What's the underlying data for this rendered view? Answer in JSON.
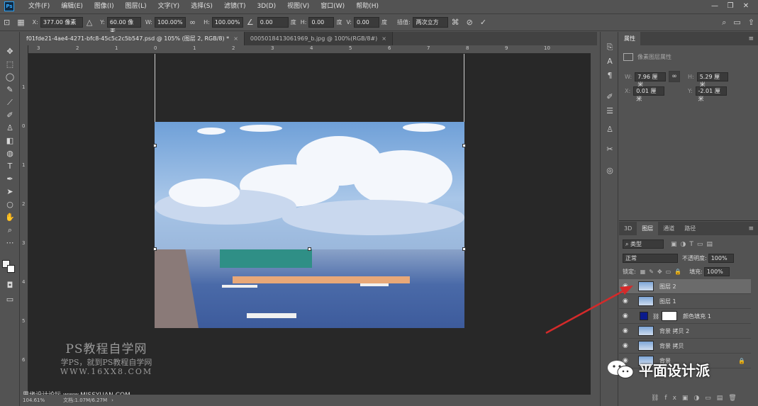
{
  "app": {
    "logo": "Ps"
  },
  "menu": [
    "文件(F)",
    "编辑(E)",
    "图像(I)",
    "图层(L)",
    "文字(Y)",
    "选择(S)",
    "滤镜(T)",
    "3D(D)",
    "视图(V)",
    "窗口(W)",
    "帮助(H)"
  ],
  "options": {
    "x_label": "X:",
    "x_value": "377.00 像素",
    "y_label": "Y:",
    "y_value": "60.00 像素",
    "w_label": "W:",
    "w_value": "100.00%",
    "h_label": "H:",
    "h_value": "100.00%",
    "angle_value": "0.00",
    "angle_unit": "度",
    "hskew_label": "H:",
    "hskew_value": "0.00",
    "hskew_unit": "度",
    "vskew_label": "V:",
    "vskew_value": "0.00",
    "vskew_unit": "度",
    "interp_label": "插值:",
    "interp_value": "两次立方"
  },
  "tabs": [
    {
      "label": "f01fde21-4ae4-4271-bfc8-45c5c2c5b547.psd @ 105% (图层 2, RGB/8) *",
      "close": "×"
    },
    {
      "label": "0005018413061969_b.jpg @ 100%(RGB/8#)",
      "close": "×"
    }
  ],
  "ruler": {
    "h_ticks": [
      "3",
      "2",
      "1",
      "0",
      "1",
      "2",
      "3",
      "4",
      "5",
      "6",
      "7",
      "8",
      "9",
      "10"
    ],
    "v_ticks": [
      "1",
      "0",
      "1",
      "2",
      "3",
      "4",
      "5",
      "6"
    ]
  },
  "status": {
    "zoom": "104.61%",
    "doc": "文档:1.07M/6.27M"
  },
  "watermark": {
    "title": "PS教程自学网",
    "subtitle": "学PS，就到PS教程自学网",
    "url": "WWW.16XX8.COM",
    "bottom": "思缘设计论坛 www.MISSYUAN.COM"
  },
  "properties": {
    "tab": "属性",
    "subtitle": "像素图层属性",
    "w_label": "W:",
    "w_value": "7.96 厘米",
    "h_label": "H:",
    "h_value": "5.29 厘米",
    "x_label": "X:",
    "x_value": "0.01 厘米",
    "y_label": "Y:",
    "y_value": "-2.01 厘米"
  },
  "layers_panel": {
    "tabs": [
      "3D",
      "图层",
      "通道",
      "路径"
    ],
    "filter": "类型",
    "blend": "正常",
    "opacity_label": "不透明度:",
    "opacity_value": "100%",
    "lock_label": "锁定:",
    "fill_label": "填充:",
    "fill_value": "100%",
    "layers": [
      {
        "name": "图层 2",
        "selected": true
      },
      {
        "name": "图层 1",
        "selected": false
      },
      {
        "name": "颜色填充 1",
        "selected": false
      },
      {
        "name": "背景 拷贝 2",
        "selected": false
      },
      {
        "name": "背景 拷贝",
        "selected": false
      },
      {
        "name": "背景",
        "selected": false
      }
    ]
  },
  "brand": {
    "text": "平面设计派"
  },
  "colors": {
    "accent": "#31a8ff",
    "arrow": "#d42a2a",
    "fill_layer": "#0a1a8c"
  }
}
